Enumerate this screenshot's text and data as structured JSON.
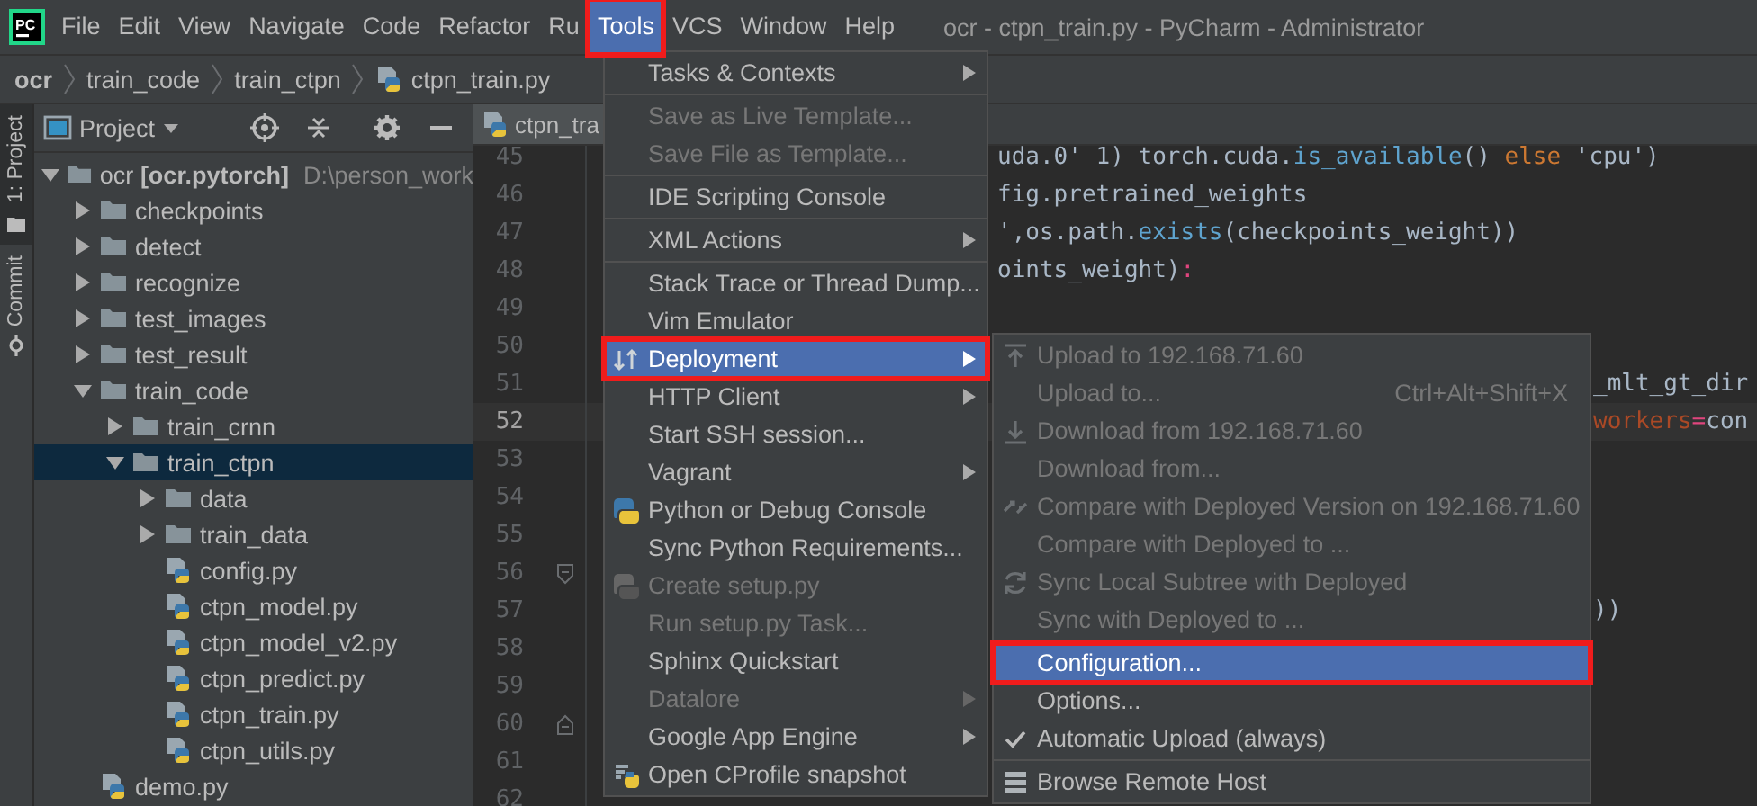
{
  "menubar": {
    "logo": "PC",
    "items": [
      {
        "label": "File",
        "selected": false,
        "framed": false
      },
      {
        "label": "Edit",
        "selected": false,
        "framed": false
      },
      {
        "label": "View",
        "selected": false,
        "framed": false
      },
      {
        "label": "Navigate",
        "selected": false,
        "framed": false
      },
      {
        "label": "Code",
        "selected": false,
        "framed": false
      },
      {
        "label": "Refactor",
        "selected": false,
        "framed": false
      },
      {
        "label": "Ru",
        "selected": false,
        "framed": false
      },
      {
        "label": "Tools",
        "selected": true,
        "framed": true
      },
      {
        "label": "VCS",
        "selected": false,
        "framed": false
      },
      {
        "label": "Window",
        "selected": false,
        "framed": false
      },
      {
        "label": "Help",
        "selected": false,
        "framed": false
      }
    ],
    "title": "ocr - ctpn_train.py - PyCharm - Administrator"
  },
  "breadcrumbs": [
    {
      "label": "ocr",
      "kind": "folder"
    },
    {
      "label": "train_code",
      "kind": "folder"
    },
    {
      "label": "train_ctpn",
      "kind": "folder"
    },
    {
      "label": "ctpn_train.py",
      "kind": "file"
    }
  ],
  "side_tabs": [
    {
      "label": "1: Project",
      "selected": true
    },
    {
      "label": "Commit",
      "selected": false
    }
  ],
  "project": {
    "title": "Project",
    "tree": [
      {
        "kind": "folder",
        "label": "ocr **[ocr.pytorch]**",
        "path": "D:\\person_work",
        "expanded": true,
        "selected": false,
        "children": [
          {
            "kind": "folder",
            "label": "checkpoints",
            "expanded": false,
            "selected": false
          },
          {
            "kind": "folder",
            "label": "detect",
            "expanded": false,
            "selected": false
          },
          {
            "kind": "folder",
            "label": "recognize",
            "expanded": false,
            "selected": false
          },
          {
            "kind": "folder",
            "label": "test_images",
            "expanded": false,
            "selected": false
          },
          {
            "kind": "folder",
            "label": "test_result",
            "expanded": false,
            "selected": false
          },
          {
            "kind": "folder",
            "label": "train_code",
            "expanded": true,
            "selected": false,
            "children": [
              {
                "kind": "folder",
                "label": "train_crnn",
                "expanded": false,
                "selected": false
              },
              {
                "kind": "folder",
                "label": "train_ctpn",
                "expanded": true,
                "selected": true,
                "children": [
                  {
                    "kind": "folder",
                    "label": "data",
                    "expanded": false,
                    "selected": false
                  },
                  {
                    "kind": "folder",
                    "label": "train_data",
                    "expanded": false,
                    "selected": false
                  },
                  {
                    "kind": "file",
                    "label": "config.py",
                    "selected": false
                  },
                  {
                    "kind": "file",
                    "label": "ctpn_model.py",
                    "selected": false
                  },
                  {
                    "kind": "file",
                    "label": "ctpn_model_v2.py",
                    "selected": false
                  },
                  {
                    "kind": "file",
                    "label": "ctpn_predict.py",
                    "selected": false
                  },
                  {
                    "kind": "file",
                    "label": "ctpn_train.py",
                    "selected": false
                  },
                  {
                    "kind": "file",
                    "label": "ctpn_utils.py",
                    "selected": false
                  }
                ]
              }
            ]
          },
          {
            "kind": "file",
            "label": "demo.py",
            "selected": false
          }
        ]
      }
    ]
  },
  "editor": {
    "tab": "ctpn_tra",
    "lines": [
      {
        "number": "45",
        "current": false,
        "segments": [
          {
            "text": "uda.0' 1) torch.cuda.",
            "kind": "plain"
          },
          {
            "text": "is_available",
            "kind": "call"
          },
          {
            "text": "() ",
            "kind": "plain"
          },
          {
            "text": "else",
            "kind": "keyword"
          },
          {
            "text": " 'cpu')",
            "kind": "plain"
          }
        ]
      },
      {
        "number": "46",
        "current": false,
        "segments": [
          {
            "text": "fig.pretrained_weights",
            "kind": "plain"
          }
        ]
      },
      {
        "number": "47",
        "current": false,
        "segments": [
          {
            "text": "',os.path.",
            "kind": "plain"
          },
          {
            "text": "exists",
            "kind": "call"
          },
          {
            "text": "(checkpoints_weight))",
            "kind": "plain"
          }
        ]
      },
      {
        "number": "48",
        "current": false,
        "segments": [
          {
            "text": "oints_weight)",
            "kind": "plain"
          },
          {
            "text": ":",
            "kind": "operator"
          }
        ]
      },
      {
        "number": "49",
        "current": false
      },
      {
        "number": "50",
        "current": false
      },
      {
        "number": "51",
        "current": false,
        "segments": [
          {
            "text": "_mlt_gt_dir",
            "kind": "plain"
          }
        ]
      },
      {
        "number": "52",
        "current": true,
        "segments": [
          {
            "text": "workers",
            "kind": "param"
          },
          {
            "text": "=",
            "kind": "operator"
          },
          {
            "text": "con",
            "kind": "plain"
          }
        ]
      },
      {
        "number": "53",
        "current": false
      },
      {
        "number": "54",
        "current": false
      },
      {
        "number": "55",
        "current": false
      },
      {
        "number": "56",
        "current": false
      },
      {
        "number": "57",
        "current": false,
        "segments": [
          {
            "text": "))",
            "kind": "plain"
          }
        ]
      },
      {
        "number": "58",
        "current": false
      },
      {
        "number": "59",
        "current": false
      },
      {
        "number": "60",
        "current": false
      },
      {
        "number": "61",
        "current": false
      },
      {
        "number": "62",
        "current": false
      }
    ]
  },
  "tools_menu": {
    "items": [
      {
        "kind": "item",
        "label": "Tasks & Contexts",
        "submenu": true,
        "disabled": false,
        "selected": false,
        "framed": false
      },
      {
        "kind": "separator"
      },
      {
        "kind": "item",
        "label": "Save as Live Template...",
        "submenu": false,
        "disabled": true,
        "selected": false,
        "framed": false
      },
      {
        "kind": "item",
        "label": "Save File as Template...",
        "submenu": false,
        "disabled": true,
        "selected": false,
        "framed": false
      },
      {
        "kind": "separator"
      },
      {
        "kind": "item",
        "label": "IDE Scripting Console",
        "submenu": false,
        "disabled": false,
        "selected": false,
        "framed": false
      },
      {
        "kind": "separator"
      },
      {
        "kind": "item",
        "label": "XML Actions",
        "submenu": true,
        "disabled": false,
        "selected": false,
        "framed": false
      },
      {
        "kind": "separator"
      },
      {
        "kind": "item",
        "label": "Stack Trace or Thread Dump...",
        "submenu": false,
        "disabled": false,
        "selected": false,
        "framed": false
      },
      {
        "kind": "item",
        "label": "Vim Emulator",
        "submenu": false,
        "disabled": false,
        "selected": false,
        "framed": false
      },
      {
        "kind": "item",
        "label": "Deployment",
        "submenu": true,
        "disabled": false,
        "selected": true,
        "framed": true
      },
      {
        "kind": "item",
        "label": "HTTP Client",
        "submenu": true,
        "disabled": false,
        "selected": false,
        "framed": false
      },
      {
        "kind": "item",
        "label": "Start SSH session...",
        "submenu": false,
        "disabled": false,
        "selected": false,
        "framed": false
      },
      {
        "kind": "item",
        "label": "Vagrant",
        "submenu": true,
        "disabled": false,
        "selected": false,
        "framed": false
      },
      {
        "kind": "item",
        "label": "Python or Debug Console",
        "submenu": false,
        "disabled": false,
        "selected": false,
        "framed": false
      },
      {
        "kind": "item",
        "label": "Sync Python Requirements...",
        "submenu": false,
        "disabled": false,
        "selected": false,
        "framed": false
      },
      {
        "kind": "item",
        "label": "Create setup.py",
        "submenu": false,
        "disabled": true,
        "selected": false,
        "framed": false
      },
      {
        "kind": "item",
        "label": "Run setup.py Task...",
        "submenu": false,
        "disabled": true,
        "selected": false,
        "framed": false
      },
      {
        "kind": "item",
        "label": "Sphinx Quickstart",
        "submenu": false,
        "disabled": false,
        "selected": false,
        "framed": false
      },
      {
        "kind": "item",
        "label": "Datalore",
        "submenu": true,
        "disabled": true,
        "selected": false,
        "framed": false
      },
      {
        "kind": "item",
        "label": "Google App Engine",
        "submenu": true,
        "disabled": false,
        "selected": false,
        "framed": false
      },
      {
        "kind": "item",
        "label": "Open CProfile snapshot",
        "submenu": false,
        "disabled": false,
        "selected": false,
        "framed": false
      }
    ]
  },
  "deployment_menu": {
    "items": [
      {
        "kind": "item",
        "label": "Upload to 192.168.71.60",
        "disabled": true,
        "selected": false,
        "checked": false,
        "framed": false
      },
      {
        "kind": "item",
        "label": "Upload to...",
        "shortcut": "Ctrl+Alt+Shift+X",
        "disabled": true,
        "selected": false,
        "checked": false,
        "framed": false
      },
      {
        "kind": "item",
        "label": "Download from 192.168.71.60",
        "disabled": true,
        "selected": false,
        "checked": false,
        "framed": false
      },
      {
        "kind": "item",
        "label": "Download from...",
        "disabled": true,
        "selected": false,
        "checked": false,
        "framed": false
      },
      {
        "kind": "item",
        "label": "Compare with Deployed Version on 192.168.71.60",
        "disabled": true,
        "selected": false,
        "checked": false,
        "framed": false
      },
      {
        "kind": "item",
        "label": "Compare with Deployed to ...",
        "disabled": true,
        "selected": false,
        "checked": false,
        "framed": false
      },
      {
        "kind": "item",
        "label": "Sync Local Subtree with Deployed",
        "disabled": true,
        "selected": false,
        "checked": false,
        "framed": false
      },
      {
        "kind": "item",
        "label": "Sync with Deployed to ...",
        "disabled": true,
        "selected": false,
        "checked": false,
        "framed": false
      },
      {
        "kind": "separator"
      },
      {
        "kind": "item",
        "label": "Configuration...",
        "disabled": false,
        "selected": true,
        "checked": false,
        "framed": true
      },
      {
        "kind": "item",
        "label": "Options...",
        "disabled": false,
        "selected": false,
        "checked": false,
        "framed": false
      },
      {
        "kind": "item",
        "label": "Automatic Upload (always)",
        "disabled": false,
        "selected": false,
        "checked": true,
        "framed": false
      },
      {
        "kind": "separator"
      },
      {
        "kind": "item",
        "label": "Browse Remote Host",
        "disabled": false,
        "selected": false,
        "checked": false,
        "framed": false
      }
    ]
  }
}
